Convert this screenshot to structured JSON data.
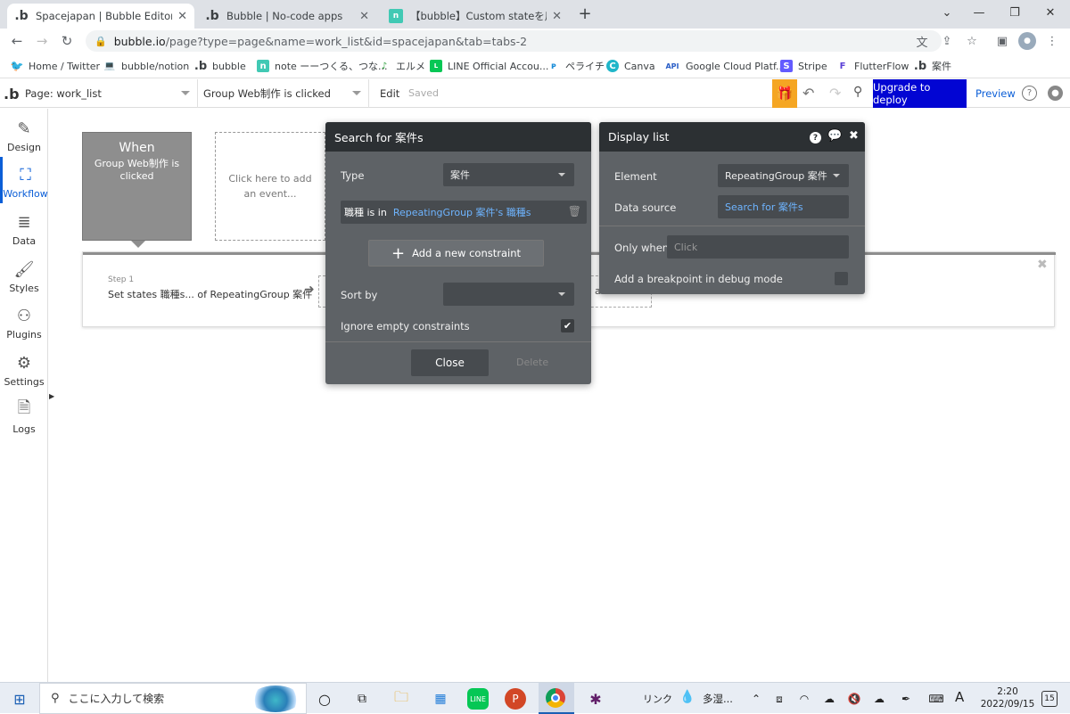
{
  "browser": {
    "tabs": [
      {
        "title": "Spacejapan | Bubble Editor",
        "favicon": "b",
        "active": true
      },
      {
        "title": "Bubble | No-code apps",
        "favicon": "b",
        "active": false
      },
      {
        "title": "【bubble】Custom stateを用いた検",
        "favicon": "note-icon",
        "active": false
      }
    ],
    "new_tab": "+",
    "url_host": "bubble.io",
    "url_path": "/page?type=page&name=work_list&id=spacejapan&tab=tabs-2",
    "bookmarks": [
      {
        "label": "Home / Twitter",
        "icon": "twitter-icon"
      },
      {
        "label": "bubble/notion",
        "icon": "laptop-icon"
      },
      {
        "label": "bubble",
        "icon": "b"
      },
      {
        "label": "note ーーつくる、つな...",
        "icon": "note-icon"
      },
      {
        "label": "エルメ",
        "icon": "L"
      },
      {
        "label": "LINE Official Accou...",
        "icon": "line-icon"
      },
      {
        "label": "ペライチ",
        "icon": "P"
      },
      {
        "label": "Canva",
        "icon": "C"
      },
      {
        "label": "Google Cloud Platf...",
        "icon": "API"
      },
      {
        "label": "Stripe",
        "icon": "S"
      },
      {
        "label": "FlutterFlow",
        "icon": "F"
      },
      {
        "label": "案件",
        "icon": "b"
      }
    ]
  },
  "editor": {
    "page_select": "Page: work_list",
    "event_select": "Group Web制作 is clicked",
    "edit_label": "Edit",
    "saved_label": "Saved",
    "deploy_button": "Upgrade to deploy",
    "preview_button": "Preview",
    "rail": [
      {
        "label": "Design",
        "icon": "design-icon"
      },
      {
        "label": "Workflow",
        "icon": "workflow-icon",
        "active": true
      },
      {
        "label": "Data",
        "icon": "data-icon"
      },
      {
        "label": "Styles",
        "icon": "styles-icon"
      },
      {
        "label": "Plugins",
        "icon": "plugins-icon"
      },
      {
        "label": "Settings",
        "icon": "settings-icon"
      },
      {
        "label": "Logs",
        "icon": "logs-icon"
      }
    ]
  },
  "workflow": {
    "when_title": "When",
    "when_desc": "Group Web制作 is clicked",
    "add_event": "Click here to add an event...",
    "step_label": "Step 1",
    "step_desc": "Set states 職種s... of RepeatingGroup 案件",
    "add_action_fragment": "a"
  },
  "search_panel": {
    "title": "Search for 案件s",
    "type_label": "Type",
    "type_value": "案件",
    "constraint_field": "職種 is in",
    "constraint_value": "RepeatingGroup 案件's 職種s",
    "add_constraint": "Add a new constraint",
    "sort_label": "Sort by",
    "sort_value": "",
    "ignore_label": "Ignore empty constraints",
    "ignore_checked": true,
    "close_button": "Close",
    "delete_button": "Delete"
  },
  "display_panel": {
    "title": "Display list",
    "element_label": "Element",
    "element_value": "RepeatingGroup 案件",
    "source_label": "Data source",
    "source_value": "Search for 案件s",
    "only_when_label": "Only when",
    "only_when_placeholder": "Click",
    "breakpoint_label": "Add a breakpoint in debug mode"
  },
  "taskbar": {
    "search_placeholder": "ここに入力して検索",
    "tray_link": "リンク",
    "weather": "多湿...",
    "ime": "A",
    "time": "2:20",
    "date": "2022/09/15",
    "notifications": "15"
  },
  "colors": {
    "accent": "#0b5ed7",
    "deploy_bg": "#0205d3",
    "panel_bg": "#5e6266",
    "panel_head": "#2c3033",
    "gift_bg": "#f5a623",
    "link_blue": "#6eb4ff"
  }
}
